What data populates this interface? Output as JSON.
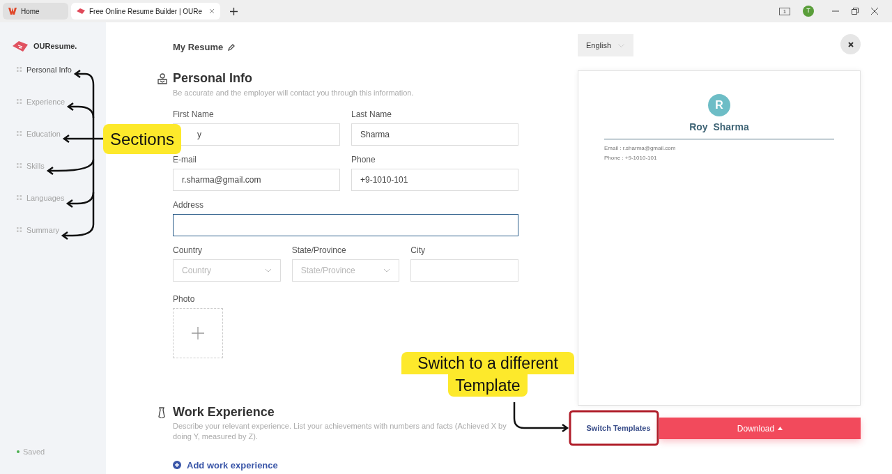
{
  "browser": {
    "tabs": [
      {
        "title": "Home",
        "selected": false
      },
      {
        "title": "Free Online Resume Builder | OURe",
        "selected": true
      }
    ],
    "tab_count": "1",
    "profile_initial": "T"
  },
  "sidebar": {
    "brand": "OUResume.",
    "items": [
      {
        "label": "Personal Info",
        "selected": true
      },
      {
        "label": "Experience",
        "selected": false
      },
      {
        "label": "Education",
        "selected": false
      },
      {
        "label": "Skills",
        "selected": false
      },
      {
        "label": "Languages",
        "selected": false
      },
      {
        "label": "Summary",
        "selected": false
      }
    ],
    "save_status": "Saved"
  },
  "editor": {
    "title": "My Resume",
    "personal_info": {
      "title": "Personal Info",
      "description": "Be accurate and the employer will contact you through this information.",
      "rows": [
        [
          {
            "kind": "text",
            "label": "First Name",
            "value": "y",
            "focused": false
          },
          {
            "kind": "text",
            "label": "Last Name",
            "value": "Sharma",
            "focused": false
          }
        ],
        [
          {
            "kind": "text",
            "label": "E-mail",
            "value": "r.sharma@gmail.com",
            "focused": false
          },
          {
            "kind": "text",
            "label": "Phone",
            "value": "+9-1010-101",
            "focused": false
          }
        ],
        [
          {
            "kind": "text",
            "label": "Address",
            "focused": true
          }
        ],
        [
          {
            "kind": "select",
            "label": "Country",
            "placeholder": "Country"
          },
          {
            "kind": "select",
            "label": "State/Province",
            "placeholder": "State/Province"
          },
          {
            "kind": "text",
            "label": "City",
            "focused": false
          }
        ]
      ],
      "photo_label": "Photo"
    },
    "work_experience": {
      "title": "Work Experience",
      "description": "Describe your relevant experience. List your achievements with numbers and facts (Achieved X by doing Y, measured by Z).",
      "add_button": "Add work experience"
    }
  },
  "preview": {
    "language": "English",
    "avatar_initial": "R",
    "name": "Roy  Sharma",
    "contact_lines": [
      "Email : r.sharma@gmail.com",
      "Phone : +9-1010-101"
    ],
    "switch_button": "Switch Templates",
    "download_button": "Download"
  },
  "annotations": [
    {
      "lines": [
        "Sections"
      ]
    },
    {
      "lines": [
        "Switch to a different",
        "Template"
      ]
    }
  ]
}
